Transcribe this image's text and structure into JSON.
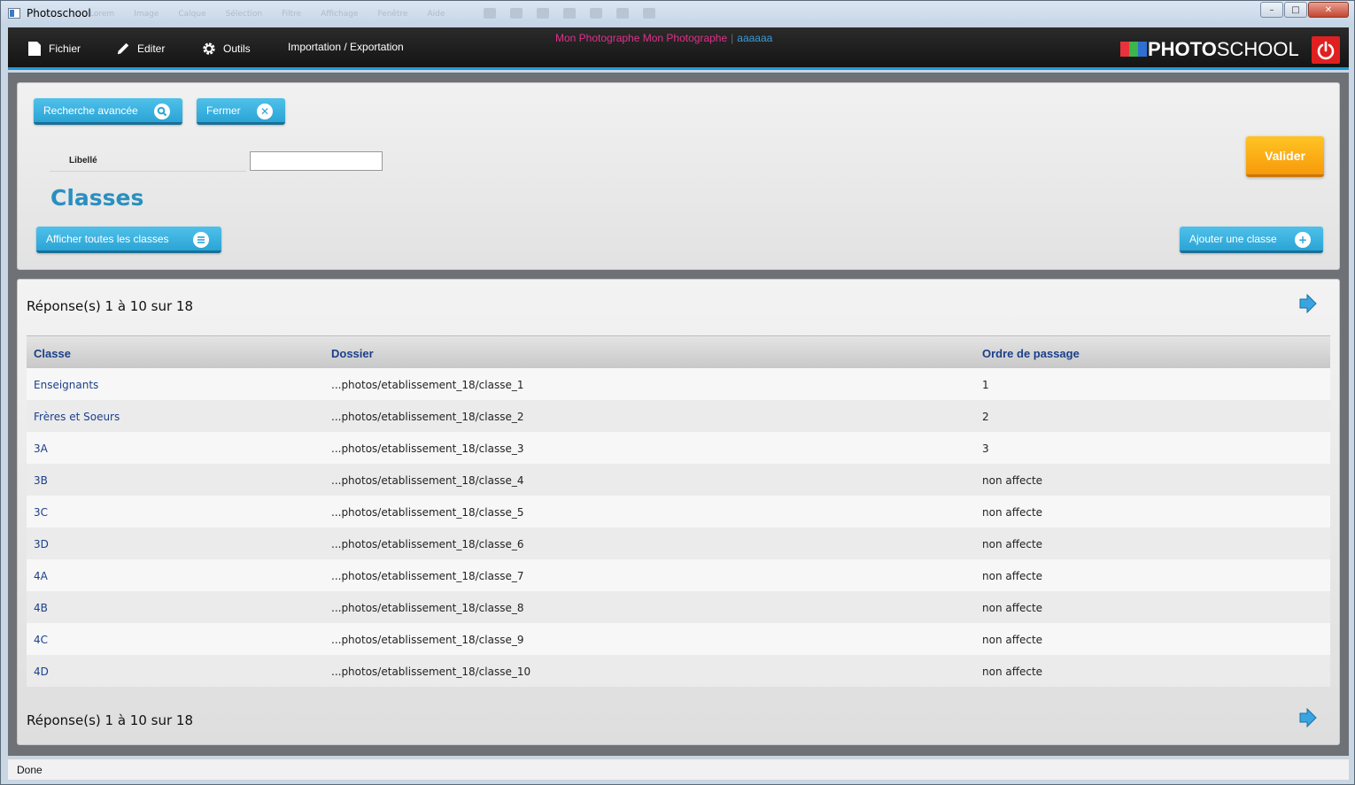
{
  "window": {
    "title": "Photoschool",
    "ghost_menu": [
      "Lorem",
      "Image",
      "Calque",
      "Sélection",
      "Filtre",
      "Affichage",
      "Fenêtre",
      "Aide"
    ],
    "controls": {
      "minimize": "–",
      "maximize": "□",
      "close": "✕"
    }
  },
  "menubar": {
    "items": [
      {
        "label": "Fichier",
        "icon": "file-icon"
      },
      {
        "label": "Editer",
        "icon": "pencil-icon"
      },
      {
        "label": "Outils",
        "icon": "gear-icon"
      },
      {
        "label": "Importation / Exportation",
        "icon": ""
      }
    ],
    "user_name": "Mon Photographe Mon Photographe",
    "separator": "|",
    "user_login": "aaaaaa",
    "brand_bold": "PHOTO",
    "brand_light": "SCHOOL",
    "brand_colors": [
      "#e8333a",
      "#3db54a",
      "#2f6fd1"
    ],
    "power_color": "#e02020"
  },
  "search": {
    "advanced_label": "Recherche avancée",
    "close_label": "Fermer",
    "field_label": "Libellé",
    "field_value": "",
    "validate_label": "Valider"
  },
  "page": {
    "title": "Classes",
    "show_all_label": "Afficher toutes les classes",
    "add_label": "Ajouter une classe"
  },
  "list": {
    "results_top": "Réponse(s) 1 à 10 sur 18",
    "results_bottom": "Réponse(s) 1 à 10 sur 18",
    "columns": [
      "Classe",
      "Dossier",
      "Ordre de passage"
    ],
    "rows": [
      [
        "Enseignants",
        "...photos/etablissement_18/classe_1",
        "1"
      ],
      [
        "Frères et Soeurs",
        "...photos/etablissement_18/classe_2",
        "2"
      ],
      [
        "3A",
        "...photos/etablissement_18/classe_3",
        "3"
      ],
      [
        "3B",
        "...photos/etablissement_18/classe_4",
        "non affecte"
      ],
      [
        "3C",
        "...photos/etablissement_18/classe_5",
        "non affecte"
      ],
      [
        "3D",
        "...photos/etablissement_18/classe_6",
        "non affecte"
      ],
      [
        "4A",
        "...photos/etablissement_18/classe_7",
        "non affecte"
      ],
      [
        "4B",
        "...photos/etablissement_18/classe_8",
        "non affecte"
      ],
      [
        "4C",
        "...photos/etablissement_18/classe_9",
        "non affecte"
      ],
      [
        "4D",
        "...photos/etablissement_18/classe_10",
        "non affecte"
      ]
    ]
  },
  "status": {
    "text": "Done"
  },
  "colors": {
    "accent_blue": "#2aa4d6",
    "validate_orange": "#f79a0a",
    "title_blue": "#2a8fc0",
    "link_blue": "#1b3f8a",
    "user_pink": "#e0308a"
  }
}
